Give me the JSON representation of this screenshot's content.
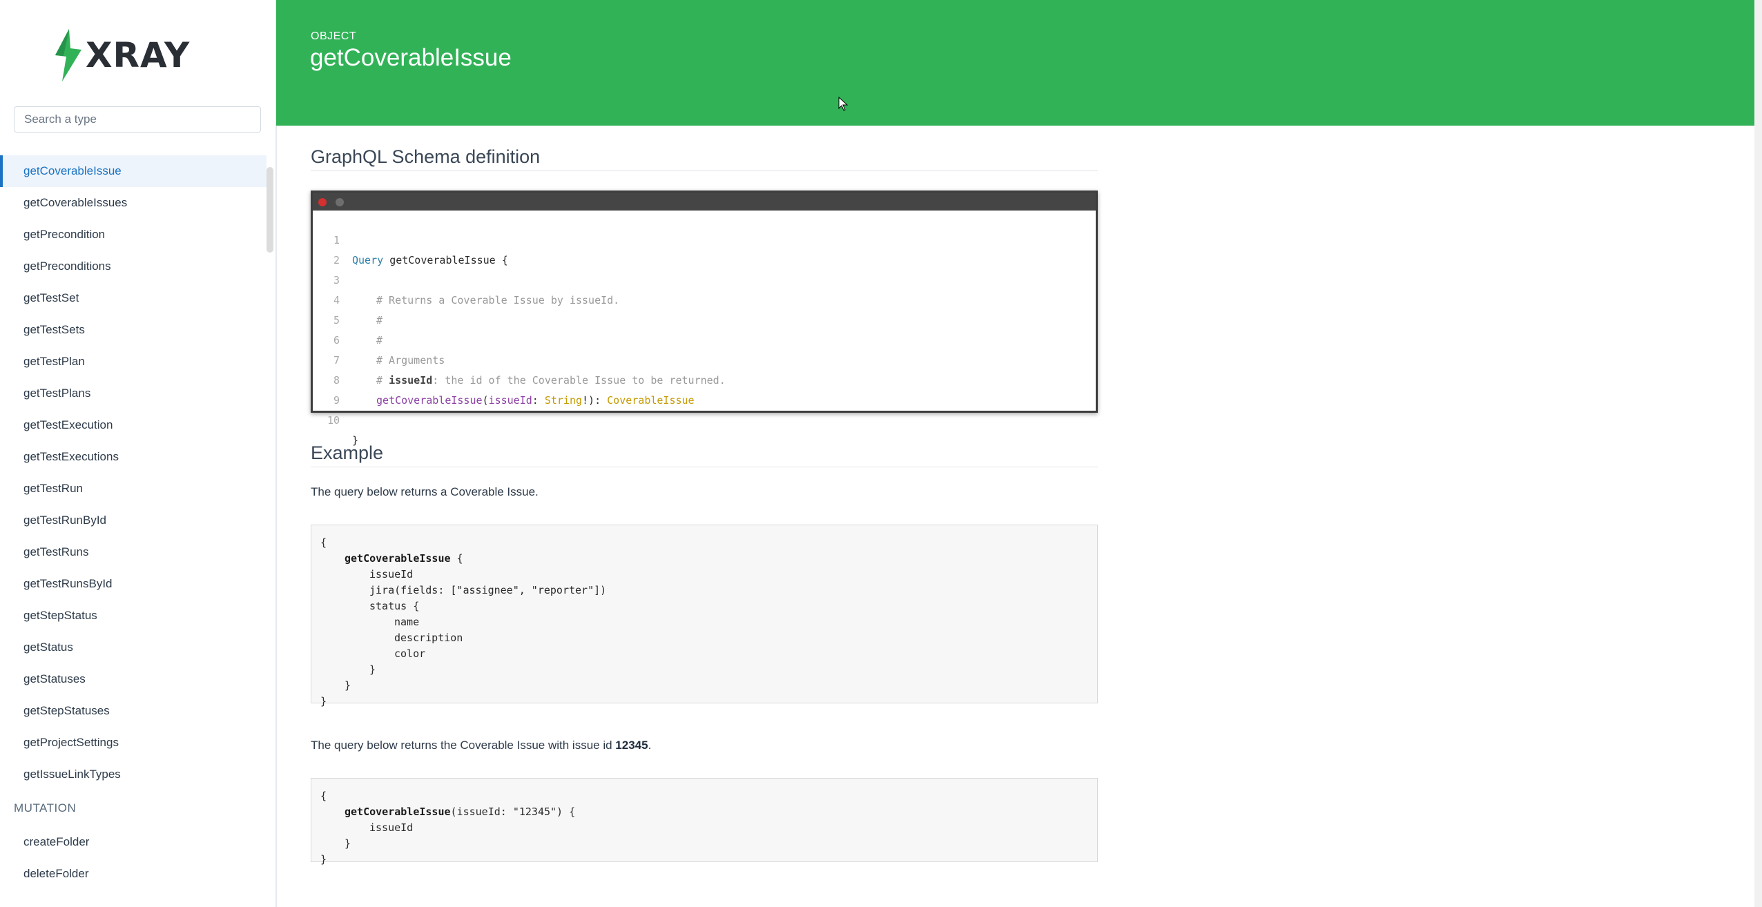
{
  "sidebar": {
    "logo_text": "XRAY",
    "search_placeholder": "Search a type",
    "query_items": [
      "getCoverableIssue",
      "getCoverableIssues",
      "getPrecondition",
      "getPreconditions",
      "getTestSet",
      "getTestSets",
      "getTestPlan",
      "getTestPlans",
      "getTestExecution",
      "getTestExecutions",
      "getTestRun",
      "getTestRunById",
      "getTestRuns",
      "getTestRunsById",
      "getStepStatus",
      "getStatus",
      "getStatuses",
      "getStepStatuses",
      "getProjectSettings",
      "getIssueLinkTypes"
    ],
    "active_item": "getCoverableIssue",
    "mutation_label": "MUTATION",
    "mutation_items": [
      "createFolder",
      "deleteFolder"
    ]
  },
  "header": {
    "kind": "OBJECT",
    "title": "getCoverableIssue",
    "bg_color": "#31b257"
  },
  "schema": {
    "heading": "GraphQL Schema definition",
    "line_numbers": [
      "1",
      "2",
      "3",
      "4",
      "5",
      "6",
      "7",
      "8",
      "9",
      "10"
    ],
    "query_keyword": "Query",
    "query_name": "getCoverableIssue",
    "open_brace": "{",
    "comment_returns": "# Returns a Coverable Issue by issueId.",
    "comment_hash_1": "#",
    "comment_hash_2": "#",
    "comment_arguments": "# Arguments",
    "comment_arg_prefix": "#",
    "comment_arg_name": "issueId",
    "comment_arg_desc": ": the id of the Coverable Issue to be returned.",
    "field_name": "getCoverableIssue",
    "arg_name": "issueId",
    "arg_type": "String",
    "arg_suffix": "!): ",
    "return_type": "CoverableIssue",
    "close_brace": "}"
  },
  "example": {
    "heading": "Example",
    "para1": "The query below returns a Coverable Issue.",
    "code1": {
      "open": "{",
      "field": "getCoverableIssue",
      "field_suffix": " {",
      "l_issueId": "issueId",
      "l_jira": "jira(fields: [\"assignee\", \"reporter\"])",
      "l_status": "status {",
      "l_name": "name",
      "l_description": "description",
      "l_color": "color",
      "l_close_inner": "}",
      "l_close_field": "}",
      "close": "}"
    },
    "para2_prefix": "The query below returns the Coverable Issue with issue id ",
    "para2_id": "12345",
    "para2_suffix": ".",
    "code2": {
      "open": "{",
      "field": "getCoverableIssue",
      "field_args": "(issueId: \"12345\") {",
      "l_issueId": "issueId",
      "l_close_field": "}",
      "close": "}"
    }
  }
}
